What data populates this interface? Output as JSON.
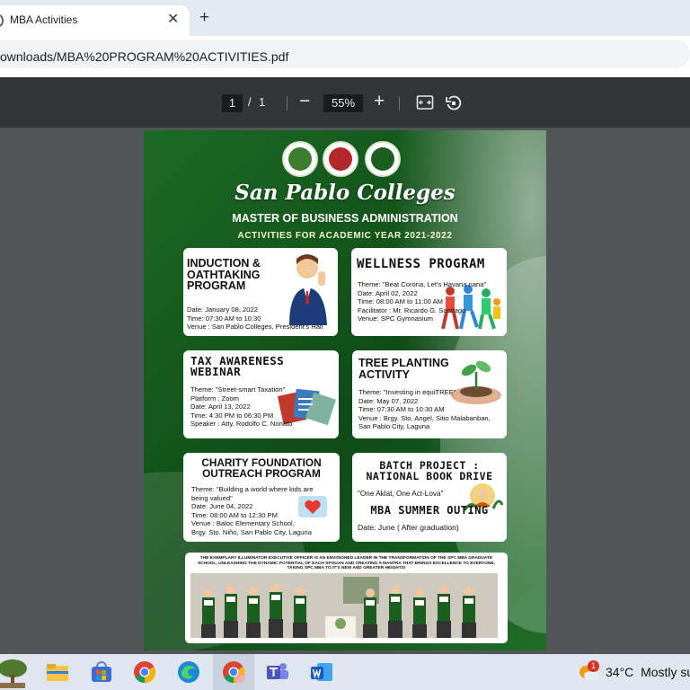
{
  "tab": {
    "title": "MBA Activities"
  },
  "address": {
    "url": "ownloads/MBA%20PROGRAM%20ACTIVITIES.pdf"
  },
  "pdf_toolbar": {
    "page_current": "1",
    "page_sep": "/",
    "page_total": "1",
    "zoom": "55%"
  },
  "poster": {
    "school": "San Pablo Colleges",
    "program": "MASTER OF BUSINESS ADMINISTRATION",
    "academic_year": "ACTIVITIES FOR ACADEMIC YEAR 2021-2022",
    "cards": {
      "induction": {
        "heading": "INDUCTION &\nOATHTAKING\nPROGRAM",
        "body": "Date: January 08, 2022\nTime: 07:30 AM to 10:30\nVenue : San Pablo Colleges, President's Hall"
      },
      "wellness": {
        "heading": "WELLNESS PROGRAM",
        "body": "Theme: \"Beat Corona, Let's Havana nana\"\nDate: April 02, 2022\nTime: 08:00 AM to 11:00 AM\nFacilitator : Mr. Ricardo G. Santiago\nVenue: SPC Gymnasium"
      },
      "tax": {
        "heading": "TAX AWARENESS\nWEBINAR",
        "body": "Theme: \"Street-smart Taxation\"\nPlatform : Zoom\nDate: April 13, 2022\nTime: 4:30 PM to 06:30 PM\nSpeaker : Atty. Rodolfo C. Nonato"
      },
      "tree": {
        "heading": "TREE PLANTING\nACTIVITY",
        "body": "Theme: \"Investing in equiTREE\"\nDate: May 07, 2022\nTime: 07:30 AM to 10:30 AM\nVenue : Brgy. Sto. Angel, Sitio Malabanban,\nSan Pablo City, Laguna"
      },
      "charity": {
        "heading": "CHARITY FOUNDATION\nOUTREACH PROGRAM",
        "body": "Theme: \"Building a world where kids are\nbeing valued\"\nDate: June 04, 2022\nTime: 08:00 AM to 12:30 PM\nVenue : Baloc Elementary School,\nBrgy. Sto. Niño, San Pablo City, Laguna"
      },
      "batch": {
        "heading": "BATCH PROJECT :\nNATIONAL BOOK DRIVE",
        "theme": "\"One Aklat, One Act-Lova\"",
        "summer": "MBA SUMMER OUTING",
        "date": "Date: June ( After graduation)"
      }
    },
    "footer_text": "THE EXEMPLARY ILLUMINATOR EXECUTIVE OFFICER IS AN ENVISIONED LEADER IN THE TRANSFORMATION OF THE SPC MBA GRADUATE SCHOOL, UNLEASHING THE DYNAMIC POTENTIAL OF EACH SPOUAN AND CREATING A MANTRA THAT BRINGS EXCELLENCE TO EVERYONE, TAKING SPC MBA TO IT'S NEW AND GREATER HEIGHTS!"
  },
  "taskbar": {
    "temperature": "34°C",
    "weather": "Mostly su",
    "badge": "1"
  },
  "colors": {
    "poster_green": "#125a1c",
    "toolbar": "#333639",
    "viewer_bg": "#525659",
    "taskbar": "#dfe6ef"
  }
}
